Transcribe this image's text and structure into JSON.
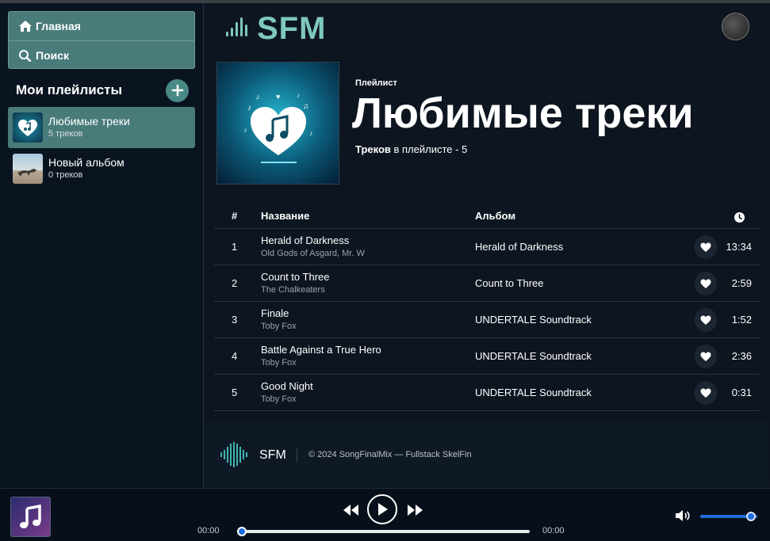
{
  "nav": {
    "home_label": "Главная",
    "search_label": "Поиск"
  },
  "sidebar": {
    "title": "Мои плейлисты",
    "playlists": [
      {
        "name": "Любимые треки",
        "count": "5 треков"
      },
      {
        "name": "Новый альбом",
        "count": "0 треков"
      }
    ]
  },
  "header": {
    "logo": "SFM"
  },
  "playlist": {
    "label": "Плейлист",
    "title": "Любимые треки",
    "meta_strong": "Треков",
    "meta_rest": " в плейлисте - 5"
  },
  "table": {
    "columns": {
      "num": "#",
      "name": "Название",
      "album": "Альбом"
    },
    "rows": [
      {
        "num": "1",
        "title": "Herald of Darkness",
        "artist": "Old Gods of Asgard, Mr. W",
        "album": "Herald of Darkness",
        "duration": "13:34"
      },
      {
        "num": "2",
        "title": "Count to Three",
        "artist": "The Chalkeaters",
        "album": "Count to Three",
        "duration": "2:59"
      },
      {
        "num": "3",
        "title": "Finale",
        "artist": "Toby Fox",
        "album": "UNDERTALE Soundtrack",
        "duration": "1:52"
      },
      {
        "num": "4",
        "title": "Battle Against a True Hero",
        "artist": "Toby Fox",
        "album": "UNDERTALE Soundtrack",
        "duration": "2:36"
      },
      {
        "num": "5",
        "title": "Good Night",
        "artist": "Toby Fox",
        "album": "UNDERTALE Soundtrack",
        "duration": "0:31"
      }
    ]
  },
  "footer": {
    "brand": "SFM",
    "copyright": "© 2024 SongFinalMix — Fullstack SkelFin"
  },
  "player": {
    "current_time": "00:00",
    "total_time": "00:00",
    "progress": 0,
    "volume": 0.9
  },
  "colors": {
    "accent": "#4a7b7b",
    "logo": "#7ec8c0",
    "progress": "#1f6de0",
    "background": "#0d1520"
  }
}
